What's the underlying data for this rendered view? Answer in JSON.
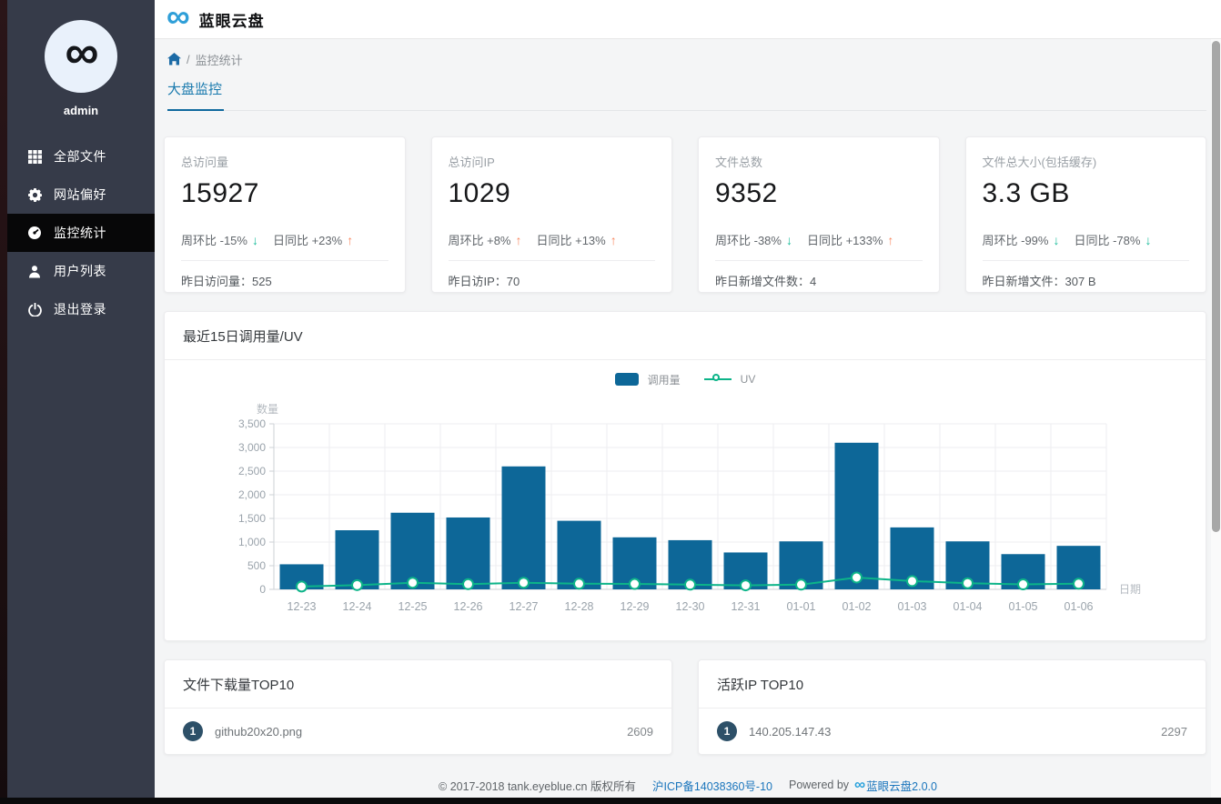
{
  "header": {
    "title": "蓝眼云盘",
    "logo": "∞"
  },
  "sidebar": {
    "avatar_glyph": "∞",
    "username": "admin",
    "items": [
      {
        "label": "全部文件",
        "icon": "grid-icon",
        "active": false
      },
      {
        "label": "网站偏好",
        "icon": "gear-icon",
        "active": false
      },
      {
        "label": "监控统计",
        "icon": "dashboard-icon",
        "active": true
      },
      {
        "label": "用户列表",
        "icon": "user-icon",
        "active": false
      },
      {
        "label": "退出登录",
        "icon": "power-icon",
        "active": false
      }
    ]
  },
  "breadcrumb": {
    "home_icon": "home-icon",
    "separator": "/",
    "current": "监控统计"
  },
  "tabs": [
    {
      "label": "大盘监控",
      "active": true
    }
  ],
  "stat_cards": [
    {
      "label": "总访问量",
      "value": "15927",
      "week_text": "周环比 -15%",
      "week_dir": "down",
      "week_arrow": "↓",
      "day_text": "日同比 +23%",
      "day_dir": "up",
      "day_arrow": "↑",
      "footer_label": "昨日访问量：",
      "footer_value": "525"
    },
    {
      "label": "总访问IP",
      "value": "1029",
      "week_text": "周环比 +8%",
      "week_dir": "up",
      "week_arrow": "↑",
      "day_text": "日同比 +13%",
      "day_dir": "up",
      "day_arrow": "↑",
      "footer_label": "昨日访IP：",
      "footer_value": "70"
    },
    {
      "label": "文件总数",
      "value": "9352",
      "week_text": "周环比 -38%",
      "week_dir": "down",
      "week_arrow": "↓",
      "day_text": "日同比 +133%",
      "day_dir": "up",
      "day_arrow": "↑",
      "footer_label": "昨日新增文件数：",
      "footer_value": "4"
    },
    {
      "label": "文件总大小(包括缓存)",
      "value": "3.3 GB",
      "week_text": "周环比 -99%",
      "week_dir": "down",
      "week_arrow": "↓",
      "day_text": "日同比 -78%",
      "day_dir": "down",
      "day_arrow": "↓",
      "footer_label": "昨日新增文件：",
      "footer_value": "307 B"
    }
  ],
  "chart_card": {
    "title": "最近15日调用量/UV"
  },
  "chart_data": {
    "type": "bar",
    "title": "最近15日调用量/UV",
    "categories": [
      "12-23",
      "12-24",
      "12-25",
      "12-26",
      "12-27",
      "12-28",
      "12-29",
      "12-30",
      "12-31",
      "01-01",
      "01-02",
      "01-03",
      "01-04",
      "01-05",
      "01-06"
    ],
    "series": [
      {
        "name": "调用量",
        "type": "bar",
        "color": "#0d6798",
        "values": [
          530,
          1250,
          1620,
          1520,
          2600,
          1450,
          1100,
          1040,
          780,
          1015,
          3100,
          1310,
          1015,
          745,
          920
        ]
      },
      {
        "name": "UV",
        "type": "line",
        "color": "#0db489",
        "values": [
          60,
          90,
          140,
          110,
          140,
          120,
          115,
          100,
          85,
          100,
          250,
          175,
          130,
          105,
          120
        ]
      }
    ],
    "xlabel": "日期",
    "ylabel": "数量",
    "ylim": [
      0,
      3500
    ],
    "yticks": [
      0,
      500,
      1000,
      1500,
      2000,
      2500,
      3000,
      3500
    ],
    "grid": true,
    "legend_position": "top-center"
  },
  "top_lists": [
    {
      "title": "文件下载量TOP10",
      "rows": [
        {
          "rank": "1",
          "name": "github20x20.png",
          "value": "2609"
        }
      ]
    },
    {
      "title": "活跃IP TOP10",
      "rows": [
        {
          "rank": "1",
          "name": "140.205.147.43",
          "value": "2297"
        }
      ]
    }
  ],
  "footer": {
    "copyright": "© 2017-2018 tank.eyeblue.cn 版权所有",
    "icp_link": "沪ICP备14038360号-10",
    "powered_prefix": "Powered by",
    "logo": "∞",
    "product_link": "蓝眼云盘2.0.0"
  },
  "colors": {
    "bar": "#0d6798",
    "line": "#0db489",
    "up_arrow": "#f9875f",
    "down_arrow": "#1bbc9b",
    "sidebar_bg": "#363b49",
    "sidebar_active_bg": "#070708",
    "accent_blue": "#1879ad",
    "link_blue": "#1a75bc"
  }
}
